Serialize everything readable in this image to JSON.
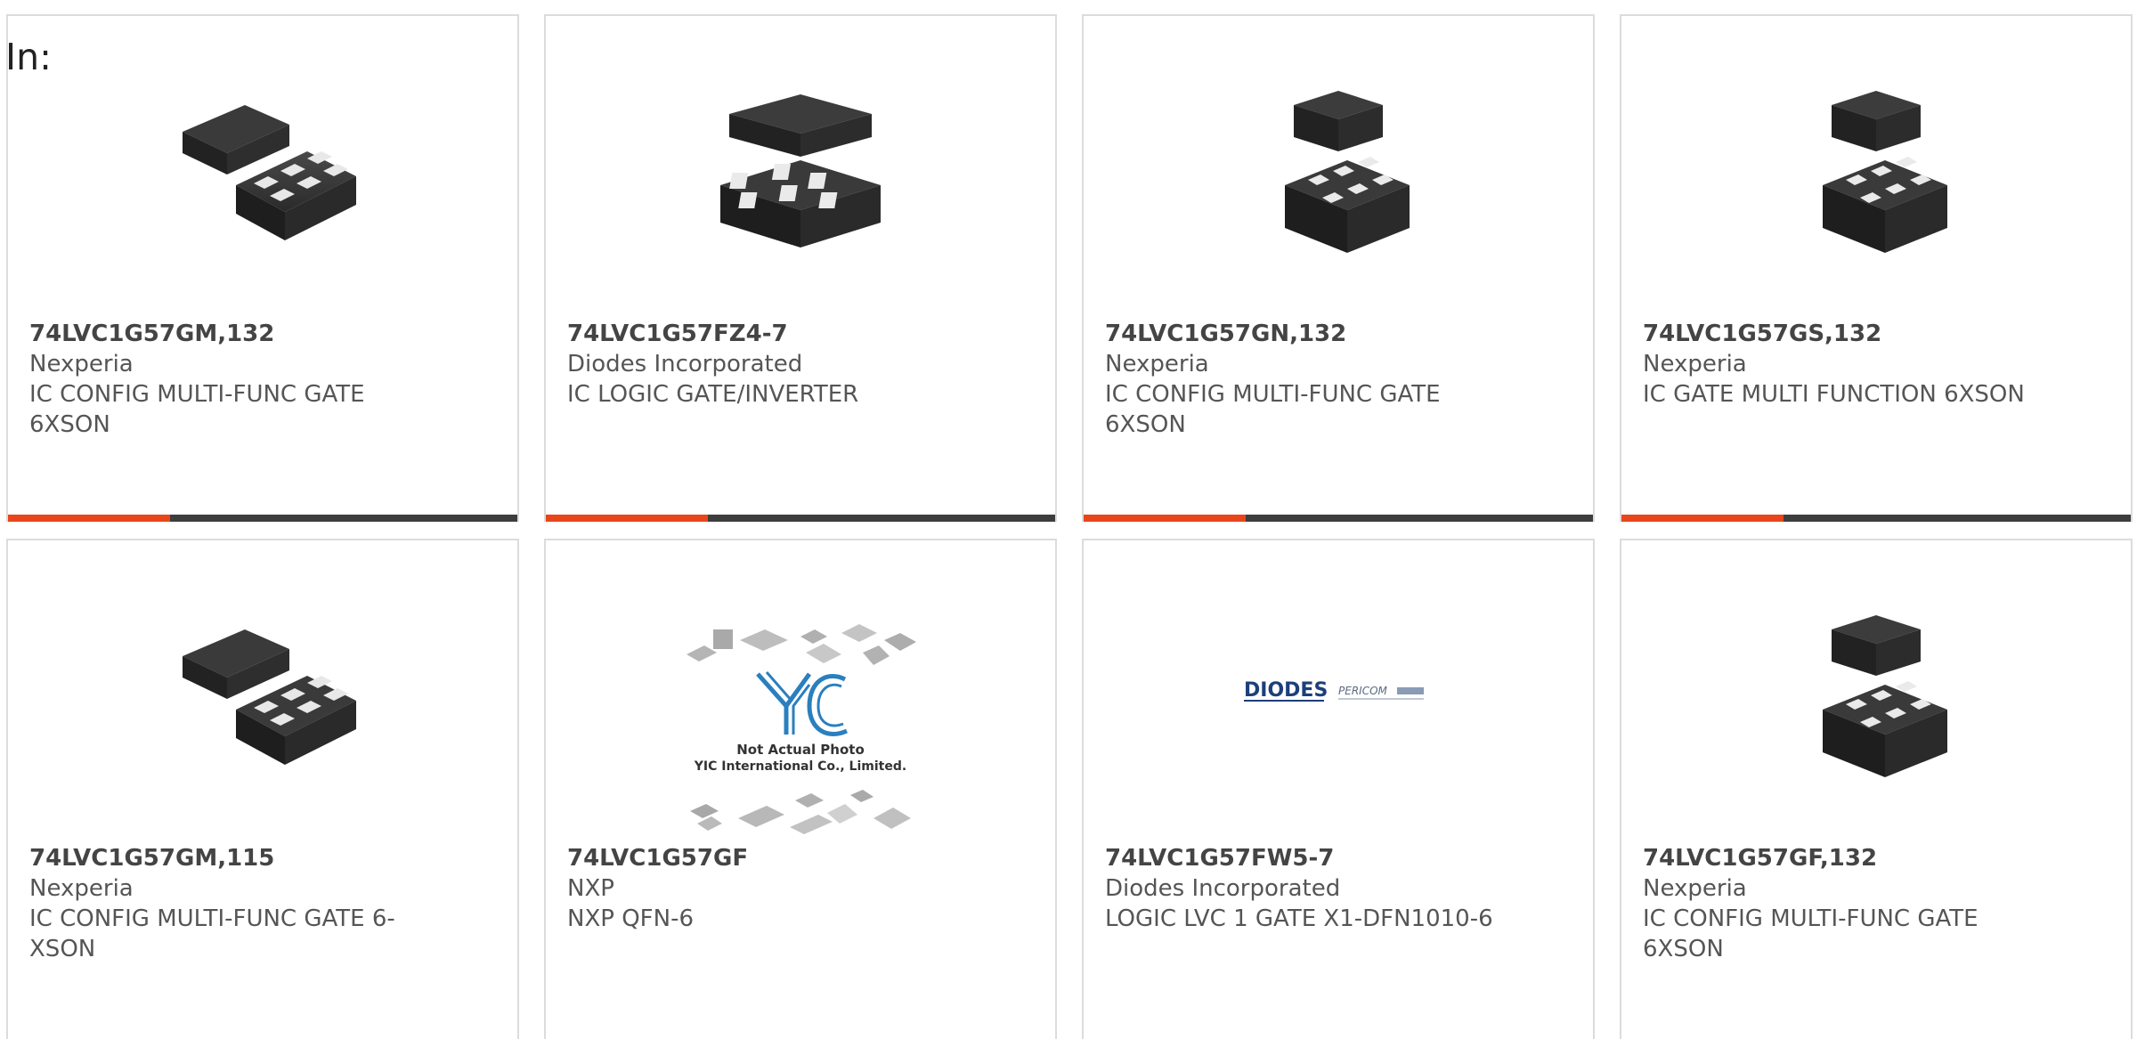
{
  "header": {
    "in_label": "In:"
  },
  "products": [
    {
      "part_number": "74LVC1G57GM,132",
      "manufacturer": "Nexperia",
      "description": "IC CONFIG MULTI-FUNC GATE 6XSON",
      "image": "xson-package-chip-icon",
      "has_bar": true
    },
    {
      "part_number": "74LVC1G57FZ4-7",
      "manufacturer": "Diodes Incorporated",
      "description": "IC LOGIC GATE/INVERTER",
      "image": "xson-package-chip-icon",
      "has_bar": true
    },
    {
      "part_number": "74LVC1G57GN,132",
      "manufacturer": "Nexperia",
      "description": "IC CONFIG MULTI-FUNC GATE 6XSON",
      "image": "xson-package-chip-icon",
      "has_bar": true
    },
    {
      "part_number": "74LVC1G57GS,132",
      "manufacturer": "Nexperia",
      "description": "IC GATE MULTI FUNCTION 6XSON",
      "image": "xson-package-chip-icon",
      "has_bar": true
    },
    {
      "part_number": "74LVC1G57GM,115",
      "manufacturer": "Nexperia",
      "description": "IC CONFIG MULTI-FUNC GATE 6-XSON",
      "image": "xson-package-chip-icon",
      "has_bar": false
    },
    {
      "part_number": "74LVC1G57GF",
      "manufacturer": "NXP",
      "description": "NXP QFN-6",
      "image": "not-actual-photo-placeholder",
      "placeholder_line1": "Not Actual Photo",
      "placeholder_line2": "YIC International Co., Limited.",
      "placeholder_logo": "YIC",
      "has_bar": false
    },
    {
      "part_number": "74LVC1G57FW5-7",
      "manufacturer": "Diodes Incorporated",
      "description": "LOGIC LVC 1 GATE X1-DFN1010-6",
      "image": "diodes-pericom-logo",
      "logo_text_1": "DIODES",
      "logo_text_2": "PERICOM",
      "has_bar": false
    },
    {
      "part_number": "74LVC1G57GF,132",
      "manufacturer": "Nexperia",
      "description": "IC CONFIG MULTI-FUNC GATE 6XSON",
      "image": "xson-package-chip-icon",
      "has_bar": false
    }
  ],
  "colors": {
    "accent": "#e8461a",
    "bar": "#3d3d3d",
    "border": "#dcdcdc",
    "text": "#555555"
  }
}
